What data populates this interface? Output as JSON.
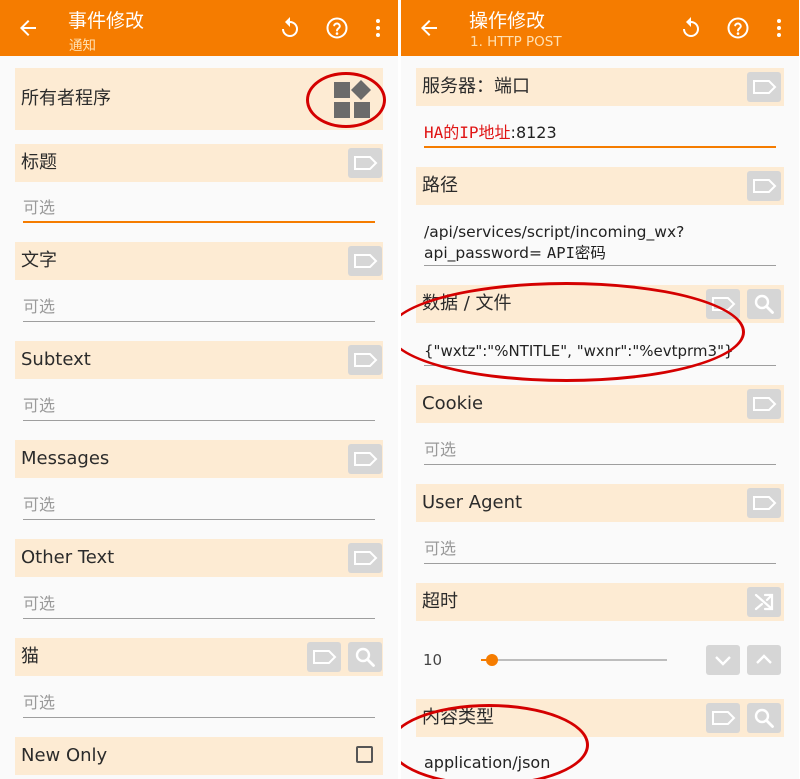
{
  "left": {
    "title": "事件修改",
    "subtitle": "通知",
    "owner_label": "所有者程序",
    "fields": [
      {
        "label": "标题",
        "placeholder": "可选"
      },
      {
        "label": "文字",
        "placeholder": "可选"
      },
      {
        "label": "Subtext",
        "placeholder": "可选"
      },
      {
        "label": "Messages",
        "placeholder": "可选"
      },
      {
        "label": "Other Text",
        "placeholder": "可选"
      },
      {
        "label": "猫",
        "placeholder": "可选"
      }
    ],
    "new_only_label": "New Only",
    "new_only_checked": false
  },
  "right": {
    "title": "操作修改",
    "subtitle": "1. HTTP POST",
    "server_label": "服务器：端口",
    "server_value_annotation": "HA的IP地址",
    "server_value": ":8123",
    "path_label": "路径",
    "path_line1": "/api/services/script/incoming_wx?",
    "path_line2_prefix": "api_password= ",
    "path_annotation": "API密码",
    "data_label": "数据 / 文件",
    "data_value": "{\"wxtz\":\"%NTITLE\", \"wxnr\":\"%evtprm3\"}",
    "cookie_label": "Cookie",
    "cookie_placeholder": "可选",
    "ua_label": "User Agent",
    "ua_placeholder": "可选",
    "timeout_label": "超时",
    "timeout_value": "10",
    "timeout_fraction": 0.06,
    "content_type_label": "内容类型",
    "content_type_value": "application/json"
  },
  "colors": {
    "appbar": "#f57c00",
    "band": "#fdebd3",
    "accent": "#f57c00",
    "annotation": "#d40000"
  },
  "icons": {
    "back": "arrow-back-icon",
    "undo": "undo-icon",
    "help": "help-circle-icon",
    "more": "more-vert-icon",
    "app": "apps-widget-icon",
    "tag": "label-tag-icon",
    "search": "search-icon",
    "random": "shuffle-icon",
    "down": "chevron-down-icon",
    "up": "chevron-up-icon"
  }
}
